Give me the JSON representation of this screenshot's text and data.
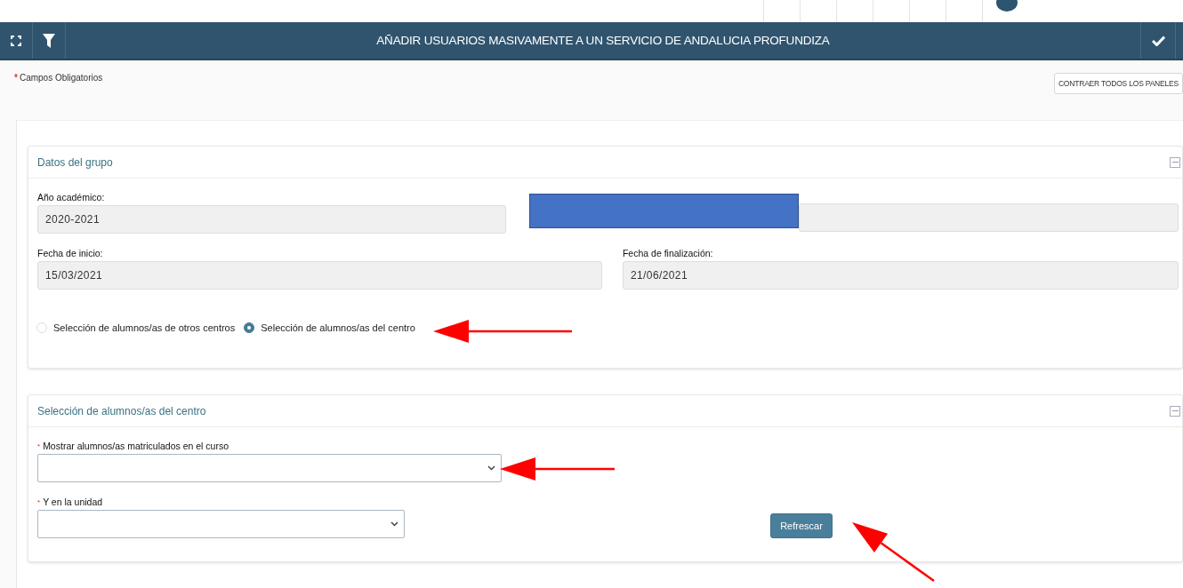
{
  "header": {
    "title": "AÑADIR USUARIOS MASIVAMENTE A UN SERVICIO DE ANDALUCIA PROFUNDIZA"
  },
  "required_note": {
    "mark": "*",
    "text": "Campos Obligatorios"
  },
  "collapse_all_button": "CONTRAER TODOS LOS PANELES",
  "group_panel": {
    "title": "Datos del grupo",
    "field_rows": [
      [
        {
          "kind": "readonly",
          "label": "Año académico:",
          "value": "2020-2021"
        },
        {
          "kind": "redacted"
        }
      ],
      [
        {
          "kind": "readonly",
          "label": "Fecha de inicio:",
          "value": "15/03/2021"
        },
        {
          "kind": "readonly",
          "label": "Fecha de finalización:",
          "value": "21/06/2021"
        }
      ]
    ],
    "radios": [
      {
        "label": "Selección de alumnos/as de otros centros",
        "selected": false
      },
      {
        "label": "Selección de alumnos/as del centro",
        "selected": true
      }
    ]
  },
  "selection_panel": {
    "title": "Selección de alumnos/as del centro",
    "selects": [
      {
        "required_mark": "*",
        "label": "Mostrar alumnos/as matriculados en el curso"
      },
      {
        "required_mark": "*",
        "label": "Y en la unidad"
      }
    ],
    "button": "Refrescar"
  }
}
